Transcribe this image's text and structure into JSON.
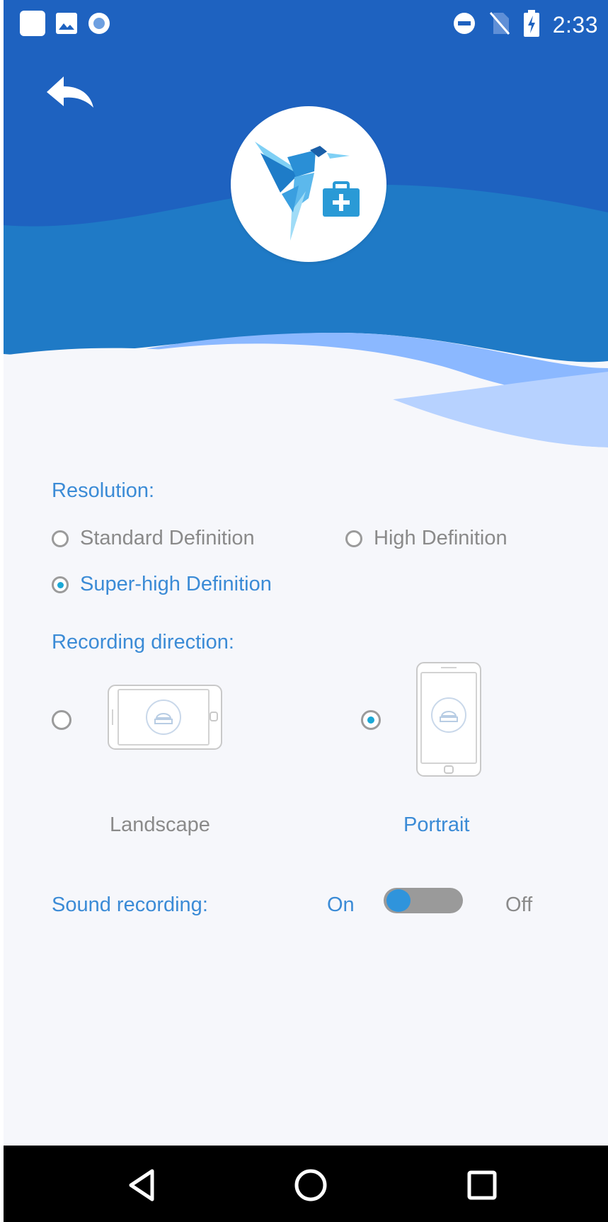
{
  "status_bar": {
    "time": "2:33",
    "left_icons": [
      "app-square-icon",
      "image-icon",
      "record-icon"
    ],
    "right_icons": [
      "do-not-disturb-icon",
      "no-sim-icon",
      "battery-charging-icon"
    ]
  },
  "header": {
    "back_icon": "back-arrow-icon",
    "logo_icon": "bird-with-medical-kit-logo",
    "colors": {
      "dark_blue": "#1e62c0",
      "mid_blue": "#1f7ac6",
      "light_wave": "#8bb8ff",
      "lighter_wave": "#b7d2ff"
    }
  },
  "settings": {
    "resolution": {
      "label": "Resolution:",
      "options": [
        {
          "label": "Standard Definition",
          "selected": false
        },
        {
          "label": "High Definition",
          "selected": false
        },
        {
          "label": "Super-high Definition",
          "selected": true
        }
      ]
    },
    "recording_direction": {
      "label": "Recording direction:",
      "options": [
        {
          "label": "Landscape",
          "selected": false,
          "icon": "landscape-phone-icon"
        },
        {
          "label": "Portrait",
          "selected": true,
          "icon": "portrait-phone-icon"
        }
      ]
    },
    "sound_recording": {
      "label": "Sound recording:",
      "on_label": "On",
      "off_label": "Off",
      "state": "On"
    },
    "accent_color": "#3b8bd6",
    "radio_dot_color": "#1ba8d6"
  },
  "nav_bar": {
    "icons": [
      "back-triangle-icon",
      "home-circle-icon",
      "recents-square-icon"
    ]
  }
}
